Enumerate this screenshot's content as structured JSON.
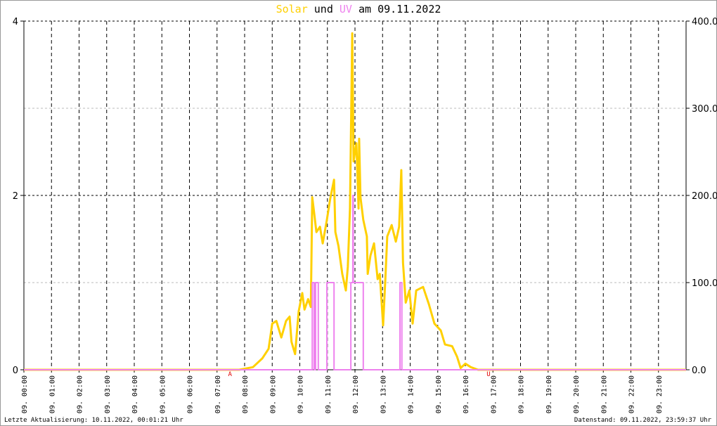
{
  "chart_data": {
    "type": "line",
    "title_parts": {
      "s1": "Solar",
      "mid": "und",
      "s2": "UV",
      "rest": "am 09.11.2022"
    },
    "colors": {
      "solar": "#ffd000",
      "uv": "#ee82ee",
      "marker": "#e00000"
    },
    "x_range_hours": [
      0,
      24
    ],
    "x_tick_labels": [
      "09. 00:00",
      "09. 01:00",
      "09. 02:00",
      "09. 03:00",
      "09. 04:00",
      "09. 05:00",
      "09. 06:00",
      "09. 07:00",
      "09. 08:00",
      "09. 09:00",
      "09. 10:00",
      "09. 11:00",
      "09. 12:00",
      "09. 13:00",
      "09. 14:00",
      "09. 15:00",
      "09. 16:00",
      "09. 17:00",
      "09. 18:00",
      "09. 19:00",
      "09. 20:00",
      "09. 21:00",
      "09. 22:00",
      "09. 23:00"
    ],
    "y_left": {
      "range": [
        0,
        4
      ],
      "tick_labels": [
        "0",
        "2",
        "4"
      ],
      "ticks": [
        0,
        2,
        4
      ]
    },
    "y_right": {
      "range": [
        0,
        400
      ],
      "tick_labels": [
        "0.0",
        "100.0",
        "200.0",
        "300.0",
        "400.0"
      ],
      "ticks": [
        0,
        100,
        200,
        300,
        400
      ]
    },
    "markers": [
      {
        "label": "A",
        "hour": 7.47
      },
      {
        "label": "U",
        "hour": 16.84
      }
    ],
    "series": [
      {
        "name": "Solar",
        "axis": "left",
        "points": [
          [
            0,
            0
          ],
          [
            7.8,
            0
          ],
          [
            8.3,
            0.03
          ],
          [
            8.64,
            0.13
          ],
          [
            8.87,
            0.24
          ],
          [
            9.0,
            0.53
          ],
          [
            9.15,
            0.56
          ],
          [
            9.33,
            0.37
          ],
          [
            9.5,
            0.56
          ],
          [
            9.63,
            0.61
          ],
          [
            9.7,
            0.32
          ],
          [
            9.83,
            0.18
          ],
          [
            9.96,
            0.67
          ],
          [
            10.09,
            0.88
          ],
          [
            10.17,
            0.69
          ],
          [
            10.3,
            0.81
          ],
          [
            10.4,
            0.72
          ],
          [
            10.45,
            1.98
          ],
          [
            10.52,
            1.8
          ],
          [
            10.6,
            1.58
          ],
          [
            10.73,
            1.64
          ],
          [
            10.83,
            1.45
          ],
          [
            10.98,
            1.72
          ],
          [
            11.1,
            1.96
          ],
          [
            11.24,
            2.18
          ],
          [
            11.29,
            1.58
          ],
          [
            11.4,
            1.42
          ],
          [
            11.54,
            1.1
          ],
          [
            11.67,
            0.91
          ],
          [
            11.74,
            1.18
          ],
          [
            11.82,
            1.85
          ],
          [
            11.9,
            3.86
          ],
          [
            11.95,
            2.39
          ],
          [
            12.05,
            2.6
          ],
          [
            12.13,
            1.85
          ],
          [
            12.15,
            2.65
          ],
          [
            12.2,
            1.98
          ],
          [
            12.3,
            1.72
          ],
          [
            12.43,
            1.53
          ],
          [
            12.46,
            1.1
          ],
          [
            12.56,
            1.31
          ],
          [
            12.69,
            1.45
          ],
          [
            12.82,
            1.04
          ],
          [
            12.9,
            1.1
          ],
          [
            13.02,
            0.51
          ],
          [
            13.1,
            1.04
          ],
          [
            13.17,
            1.53
          ],
          [
            13.33,
            1.66
          ],
          [
            13.48,
            1.47
          ],
          [
            13.6,
            1.64
          ],
          [
            13.68,
            2.29
          ],
          [
            13.74,
            1.23
          ],
          [
            13.84,
            0.77
          ],
          [
            13.97,
            0.91
          ],
          [
            14.09,
            0.53
          ],
          [
            14.22,
            0.91
          ],
          [
            14.47,
            0.95
          ],
          [
            14.68,
            0.75
          ],
          [
            14.88,
            0.53
          ],
          [
            15.11,
            0.45
          ],
          [
            15.26,
            0.29
          ],
          [
            15.52,
            0.27
          ],
          [
            15.7,
            0.15
          ],
          [
            15.83,
            0.02
          ],
          [
            16.0,
            0.07
          ],
          [
            16.2,
            0.03
          ],
          [
            16.46,
            0
          ],
          [
            24,
            0
          ]
        ]
      },
      {
        "name": "UV",
        "axis": "right",
        "points": [
          [
            0,
            0
          ],
          [
            10.45,
            0
          ],
          [
            10.45,
            100
          ],
          [
            10.52,
            100
          ],
          [
            10.52,
            0
          ],
          [
            10.57,
            0
          ],
          [
            10.57,
            100
          ],
          [
            10.67,
            100
          ],
          [
            10.67,
            0
          ],
          [
            10.98,
            0
          ],
          [
            10.98,
            100
          ],
          [
            11.24,
            100
          ],
          [
            11.24,
            0
          ],
          [
            11.85,
            0
          ],
          [
            11.85,
            100
          ],
          [
            11.92,
            100
          ],
          [
            11.92,
            200
          ],
          [
            11.94,
            200
          ],
          [
            11.94,
            100
          ],
          [
            12.3,
            100
          ],
          [
            12.3,
            0
          ],
          [
            13.63,
            0
          ],
          [
            13.63,
            100
          ],
          [
            13.7,
            100
          ],
          [
            13.7,
            0
          ],
          [
            24,
            0
          ]
        ]
      }
    ]
  },
  "footer": {
    "left": "Letzte Aktualisierung: 10.11.2022, 00:01:21 Uhr",
    "right": "Datenstand: 09.11.2022, 23:59:37 Uhr"
  }
}
